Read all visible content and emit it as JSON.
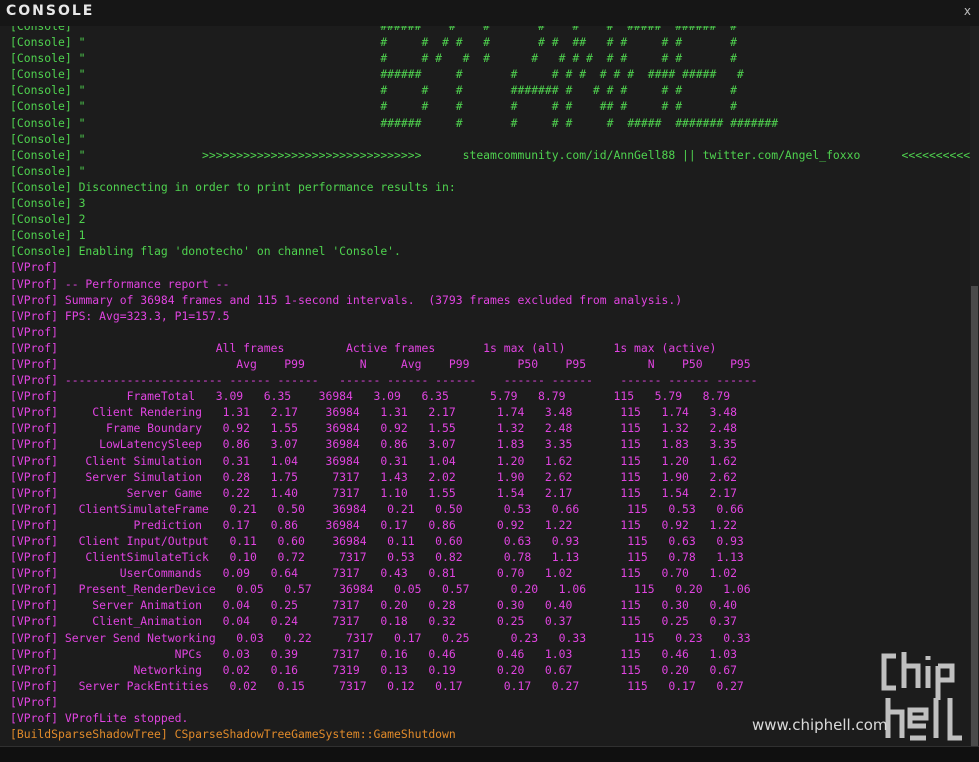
{
  "window": {
    "title": "CONSOLE",
    "close_glyph": "x"
  },
  "colors": {
    "console": "#4fd24f",
    "vprof": "#e044e0",
    "shadow": "#e08a2a",
    "bg": "#1c1c1c"
  },
  "lines": [
    {
      "c": "g",
      "t": "[Console] \"                                           ######    #    #       #    #    #  #####  ######  #"
    },
    {
      "c": "g",
      "t": "[Console] \"                                           #     #  # #   #       # #  ##   # #     # #       #"
    },
    {
      "c": "g",
      "t": "[Console] \"                                           #     # #   #  #      #   # # #  # #     # #       #"
    },
    {
      "c": "g",
      "t": "[Console] \"                                           ######     #       #     # # #  # # #  #### #####   #"
    },
    {
      "c": "g",
      "t": "[Console] \"                                           #     #    #       ####### #   # # #     # #       #"
    },
    {
      "c": "g",
      "t": "[Console] \"                                           #     #    #       #     # #    ## #     # #       #"
    },
    {
      "c": "g",
      "t": "[Console] \"                                           ######     #       #     # #     #  #####  ####### #######"
    },
    {
      "c": "g",
      "t": "[Console] \""
    },
    {
      "c": "g",
      "t": "[Console] \"                 >>>>>>>>>>>>>>>>>>>>>>>>>>>>>>>>      steamcommunity.com/id/AnnGell88 || twitter.com/Angel_foxxo      <<<<<<<<<<<<<<<<<<<<<<<<"
    },
    {
      "c": "g",
      "t": "[Console] \""
    },
    {
      "c": "g",
      "t": "[Console] Disconnecting in order to print performance results in:"
    },
    {
      "c": "g",
      "t": "[Console] 3"
    },
    {
      "c": "g",
      "t": "[Console] 2"
    },
    {
      "c": "g",
      "t": "[Console] 1"
    },
    {
      "c": "g",
      "t": "[Console] Enabling flag 'donotecho' on channel 'Console'."
    },
    {
      "c": "m",
      "t": "[VProf]"
    },
    {
      "c": "m",
      "t": "[VProf] -- Performance report --"
    },
    {
      "c": "m",
      "t": "[VProf] Summary of 36984 frames and 115 1-second intervals.  (3793 frames excluded from analysis.)"
    },
    {
      "c": "m",
      "t": "[VProf] FPS: Avg=323.3, P1=157.5"
    },
    {
      "c": "m",
      "t": "[VProf]"
    },
    {
      "c": "m",
      "t": "[VProf]                       All frames         Active frames       1s max (all)       1s max (active)"
    },
    {
      "c": "m",
      "t": "[VProf]                          Avg    P99        N     Avg    P99       P50    P95         N    P50    P95"
    },
    {
      "c": "m",
      "t": "[VProf] ----------------------- ------ ------   ------ ------ ------    ------ ------    ------ ------ ------"
    },
    {
      "c": "m",
      "t": "[VProf]          FrameTotal   3.09   6.35    36984   3.09   6.35      5.79   8.79       115   5.79   8.79"
    },
    {
      "c": "m",
      "t": "[VProf]     Client Rendering   1.31   2.17    36984   1.31   2.17      1.74   3.48       115   1.74   3.48"
    },
    {
      "c": "m",
      "t": "[VProf]       Frame Boundary   0.92   1.55    36984   0.92   1.55      1.32   2.48       115   1.32   2.48"
    },
    {
      "c": "m",
      "t": "[VProf]      LowLatencySleep   0.86   3.07    36984   0.86   3.07      1.83   3.35       115   1.83   3.35"
    },
    {
      "c": "m",
      "t": "[VProf]    Client Simulation   0.31   1.04    36984   0.31   1.04      1.20   1.62       115   1.20   1.62"
    },
    {
      "c": "m",
      "t": "[VProf]    Server Simulation   0.28   1.75     7317   1.43   2.02      1.90   2.62       115   1.90   2.62"
    },
    {
      "c": "m",
      "t": "[VProf]          Server Game   0.22   1.40     7317   1.10   1.55      1.54   2.17       115   1.54   2.17"
    },
    {
      "c": "m",
      "t": "[VProf]   ClientSimulateFrame   0.21   0.50    36984   0.21   0.50      0.53   0.66       115   0.53   0.66"
    },
    {
      "c": "m",
      "t": "[VProf]           Prediction   0.17   0.86    36984   0.17   0.86      0.92   1.22       115   0.92   1.22"
    },
    {
      "c": "m",
      "t": "[VProf]   Client Input/Output   0.11   0.60    36984   0.11   0.60      0.63   0.93       115   0.63   0.93"
    },
    {
      "c": "m",
      "t": "[VProf]    ClientSimulateTick   0.10   0.72     7317   0.53   0.82      0.78   1.13       115   0.78   1.13"
    },
    {
      "c": "m",
      "t": "[VProf]         UserCommands   0.09   0.64     7317   0.43   0.81      0.70   1.02       115   0.70   1.02"
    },
    {
      "c": "m",
      "t": "[VProf]   Present_RenderDevice   0.05   0.57    36984   0.05   0.57      0.20   1.06       115   0.20   1.06"
    },
    {
      "c": "m",
      "t": "[VProf]     Server Animation   0.04   0.25     7317   0.20   0.28      0.30   0.40       115   0.30   0.40"
    },
    {
      "c": "m",
      "t": "[VProf]     Client_Animation   0.04   0.24     7317   0.18   0.32      0.25   0.37       115   0.25   0.37"
    },
    {
      "c": "m",
      "t": "[VProf] Server Send Networking   0.03   0.22     7317   0.17   0.25      0.23   0.33       115   0.23   0.33"
    },
    {
      "c": "m",
      "t": "[VProf]                 NPCs   0.03   0.39     7317   0.16   0.46      0.46   1.03       115   0.46   1.03"
    },
    {
      "c": "m",
      "t": "[VProf]           Networking   0.02   0.16     7319   0.13   0.19      0.20   0.67       115   0.20   0.67"
    },
    {
      "c": "m",
      "t": "[VProf]   Server PackEntities   0.02   0.15     7317   0.12   0.17      0.17   0.27       115   0.17   0.27"
    },
    {
      "c": "m",
      "t": "[VProf]"
    },
    {
      "c": "m",
      "t": "[VProf] VProfLite stopped."
    },
    {
      "c": "o",
      "t": "[BuildSparseShadowTree] CSparseShadowTreeGameSystem::GameShutdown"
    }
  ],
  "watermark": {
    "site": "www.chiphell.com",
    "logo": "chiphell-logo"
  }
}
